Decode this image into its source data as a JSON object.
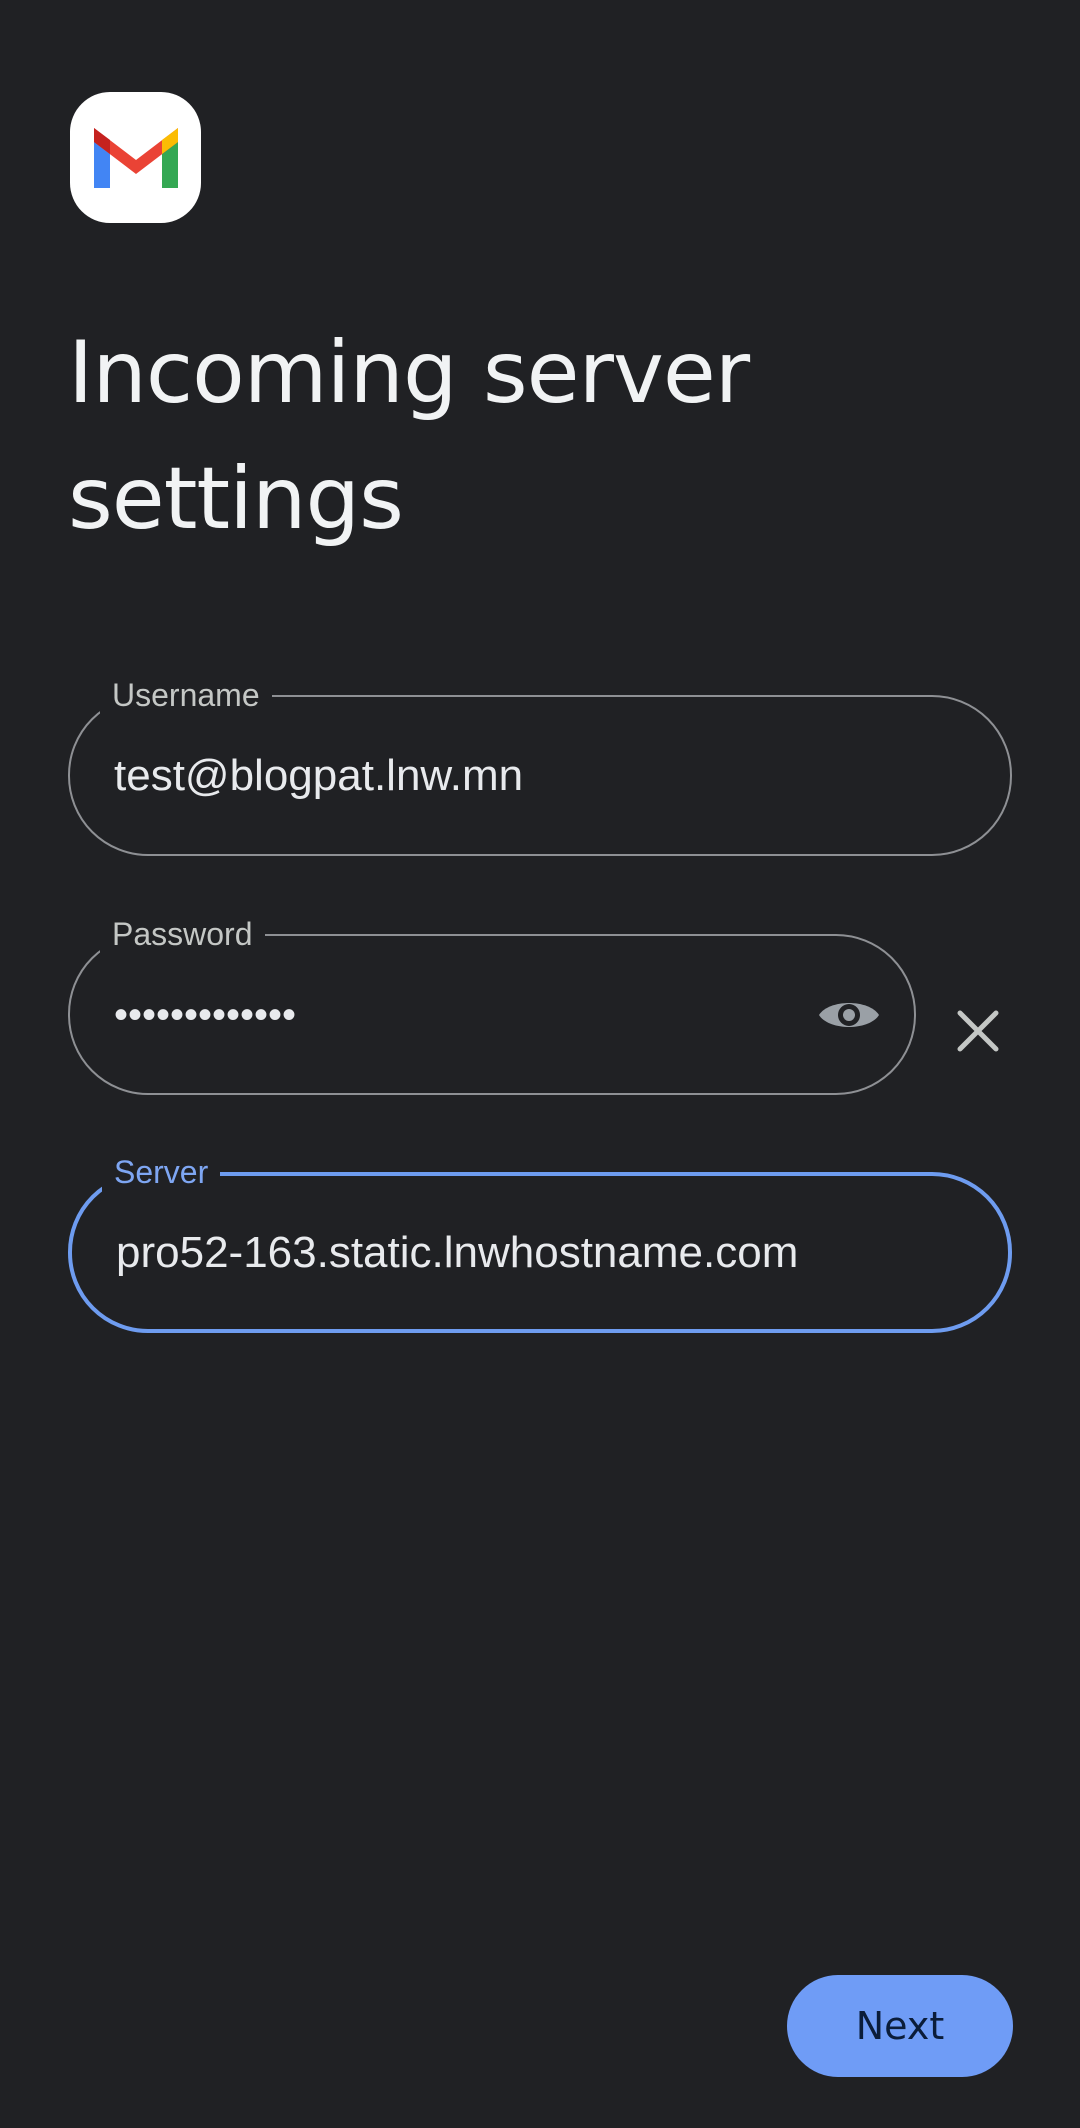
{
  "app": {
    "logo_icon": "gmail-logo-icon",
    "title": "Incoming server settings"
  },
  "form": {
    "username": {
      "label": "Username",
      "value": "test@blogpat.lnw.mn"
    },
    "password": {
      "label": "Password",
      "value": "•••••••••••••",
      "toggle_icon": "eye-icon",
      "clear_icon": "close-icon"
    },
    "server": {
      "label": "Server",
      "value": "pro52-163.static.lnwhostname.com",
      "focused": true
    }
  },
  "actions": {
    "next_label": "Next"
  },
  "colors": {
    "background": "#202124",
    "accent": "#6f9cf6",
    "focus_border": "#6e9cf0",
    "field_border": "#8e9094"
  }
}
